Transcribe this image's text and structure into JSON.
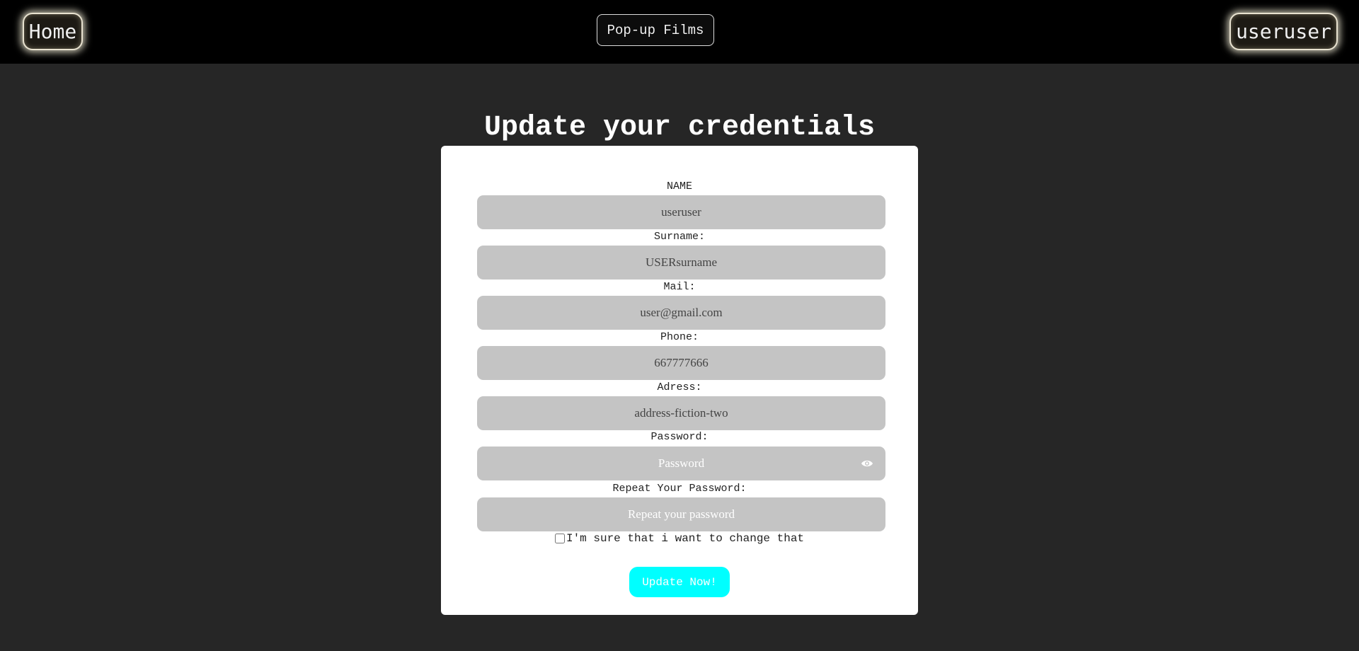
{
  "header": {
    "home_label": "Home",
    "brand_label": "Pop-up Films",
    "user_label": "useruser"
  },
  "page": {
    "title": "Update your credentials"
  },
  "form": {
    "name_label": "NAME",
    "name_value": "useruser",
    "surname_label": "Surname:",
    "surname_value": "USERsurname",
    "mail_label": "Mail:",
    "mail_value": "user@gmail.com",
    "phone_label": "Phone:",
    "phone_value": "667777666",
    "address_label": "Adress:",
    "address_value": "address-fiction-two",
    "password_label": "Password:",
    "password_placeholder": "Password",
    "repeat_label": "Repeat Your Password:",
    "repeat_placeholder": "Repeat your password",
    "confirm_label": "I'm sure that i want to change that",
    "confirm_checked": false,
    "submit_label": "Update Now!"
  },
  "icons": {
    "password_toggle": "eye-icon"
  },
  "colors": {
    "background": "#262626",
    "topbar": "#000000",
    "card": "#ffffff",
    "field": "#c4c4c4",
    "accent": "#00ffff"
  }
}
